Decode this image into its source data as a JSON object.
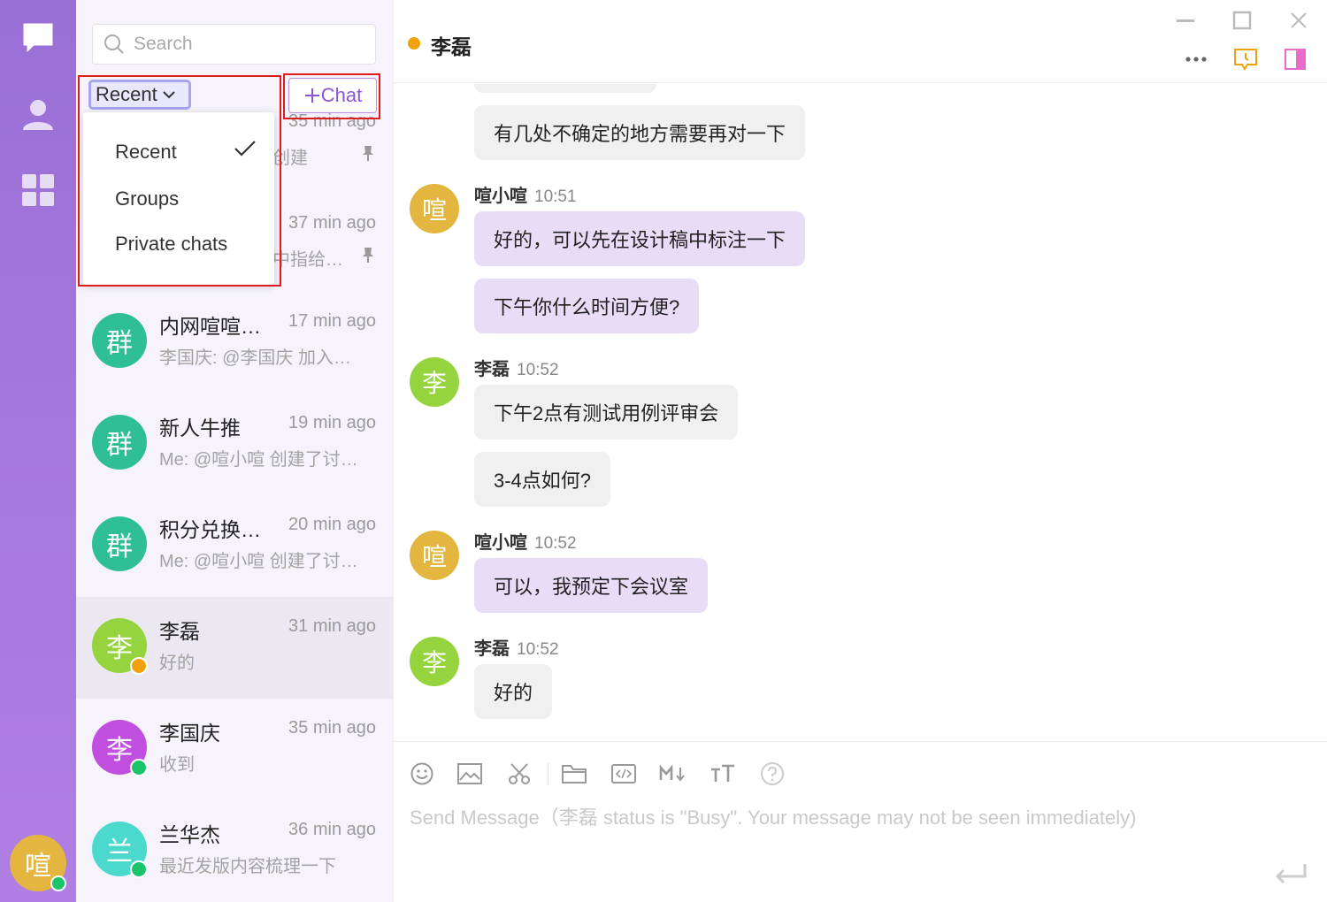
{
  "me": {
    "avatar_text": "喧",
    "avatar_color": "#e4b53f"
  },
  "search": {
    "placeholder": "Search"
  },
  "filter": {
    "label": "Recent"
  },
  "new_chat": {
    "label": "Chat"
  },
  "dropdown": {
    "items": [
      {
        "label": "Recent",
        "checked": true
      },
      {
        "label": "Groups",
        "checked": false
      },
      {
        "label": "Private chats",
        "checked": false
      }
    ]
  },
  "partial_rows": [
    {
      "time": "35 min ago",
      "preview": "创建"
    },
    {
      "time": "37 min ago",
      "preview": "中指给…"
    }
  ],
  "conversations": [
    {
      "avatar_text": "群",
      "color": "#2fbf94",
      "name": "内网喧喧…",
      "time": "17 min ago",
      "preview": "李国庆: @李国庆 加入…"
    },
    {
      "avatar_text": "群",
      "color": "#2fbf94",
      "name": "新人牛推",
      "time": "19 min ago",
      "preview": "Me: @喧小喧 创建了讨…"
    },
    {
      "avatar_text": "群",
      "color": "#2fbf94",
      "name": "积分兑换…",
      "time": "20 min ago",
      "preview": "Me: @喧小喧 创建了讨…"
    },
    {
      "avatar_text": "李",
      "color": "#96d43f",
      "name": "李磊",
      "time": "31 min ago",
      "preview": "好的",
      "status_color": "#f0a20c",
      "active": true
    },
    {
      "avatar_text": "李",
      "color": "#c04fe0",
      "name": "李国庆",
      "time": "35 min ago",
      "preview": "收到",
      "status_color": "#19c46a"
    },
    {
      "avatar_text": "兰",
      "color": "#4cd9cd",
      "name": "兰华杰",
      "time": "36 min ago",
      "preview": "最近发版内容梳理一下",
      "status_color": "#19c46a"
    }
  ],
  "chat": {
    "title": "李磊",
    "status_color": "#f0a20c",
    "messages": [
      {
        "text": "有几处不确定的地方需要再对一下",
        "style": "gray"
      },
      {
        "sender": "喧小喧",
        "time": "10:51",
        "avatar_text": "喧",
        "avatar_color": "#e4b53f",
        "text": "好的，可以先在设计稿中标注一下",
        "style": "purple"
      },
      {
        "text": "下午你什么时间方便?",
        "style": "purple"
      },
      {
        "sender": "李磊",
        "time": "10:52",
        "avatar_text": "李",
        "avatar_color": "#96d43f",
        "text": "下午2点有测试用例评审会",
        "style": "gray"
      },
      {
        "text": "3-4点如何?",
        "style": "gray"
      },
      {
        "sender": "喧小喧",
        "time": "10:52",
        "avatar_text": "喧",
        "avatar_color": "#e4b53f",
        "text": "可以，我预定下会议室",
        "style": "purple"
      },
      {
        "sender": "李磊",
        "time": "10:52",
        "avatar_text": "李",
        "avatar_color": "#96d43f",
        "text": "好的",
        "style": "gray"
      }
    ]
  },
  "composer": {
    "placeholder": "Send Message（李磊 status is \"Busy\". Your message may not be seen immediately)",
    "tools": [
      "emoji-icon",
      "image-icon",
      "scissors-icon",
      "folder-icon",
      "code-icon",
      "markdown-icon",
      "text-size-icon",
      "help-icon"
    ]
  },
  "colors": {
    "accent": "#8a56d6",
    "rail": "#a679dd",
    "busy": "#f0a20c",
    "online": "#19c46a",
    "highlight": "#e01b1b"
  }
}
